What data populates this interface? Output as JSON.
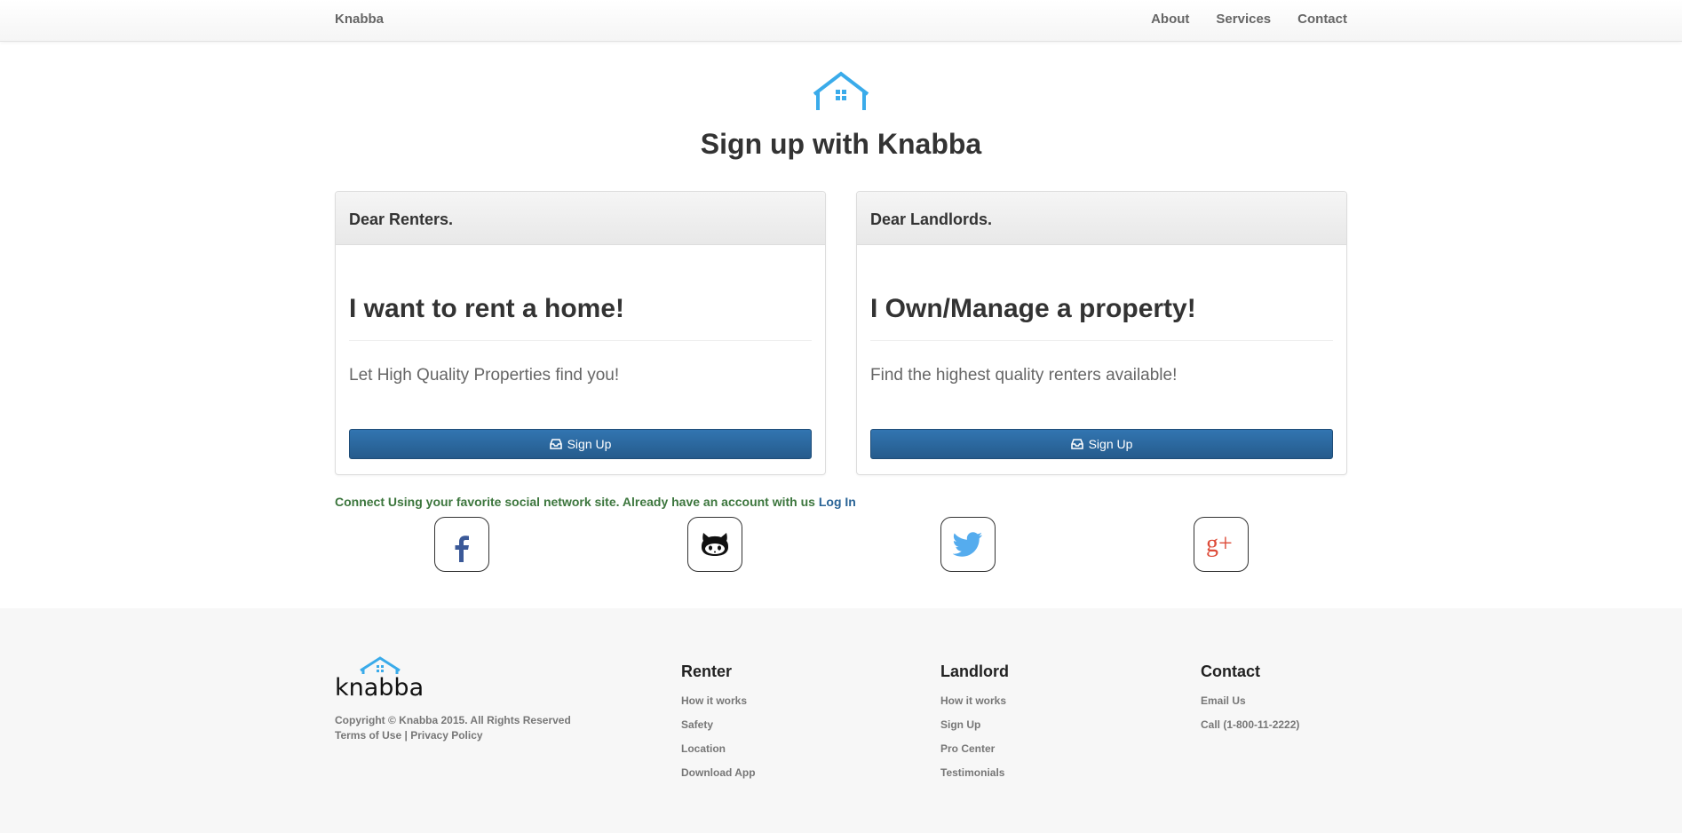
{
  "navbar": {
    "brand": "Knabba",
    "links": [
      "About",
      "Services",
      "Contact"
    ]
  },
  "hero": {
    "icon": "house-icon",
    "title": "Sign up with Knabba"
  },
  "cards": [
    {
      "header": "Dear Renters.",
      "heading": "I want to rent a home!",
      "text": "Let High Quality Properties find you!",
      "button": "Sign Up",
      "button_icon": "inbox-icon"
    },
    {
      "header": "Dear Landlords.",
      "heading": "I Own/Manage a property!",
      "text": "Find the highest quality renters available!",
      "button": "Sign Up",
      "button_icon": "inbox-icon"
    }
  ],
  "connect": {
    "text": "Connect Using your favorite social network site. Already have an account with us",
    "login_link": "Log In"
  },
  "social": [
    {
      "name": "facebook",
      "icon": "facebook-icon",
      "color": "#3b5998"
    },
    {
      "name": "github",
      "icon": "github-icon",
      "color": "#222222"
    },
    {
      "name": "twitter",
      "icon": "twitter-icon",
      "color": "#55acee"
    },
    {
      "name": "google-plus",
      "icon": "google-plus-icon",
      "color": "#dd4b39"
    }
  ],
  "footer": {
    "logo_text": "knabba",
    "copyright": "Copyright © Knabba 2015. All Rights Reserved",
    "terms": "Terms of Use",
    "separator": "|",
    "privacy": "Privacy Policy",
    "columns": [
      {
        "title": "Renter",
        "links": [
          "How it works",
          "Safety",
          "Location",
          "Download App"
        ]
      },
      {
        "title": "Landlord",
        "links": [
          "How it works",
          "Sign Up",
          "Pro Center",
          "Testimonials"
        ]
      },
      {
        "title": "Contact",
        "links": [
          "Email Us",
          "Call (1-800-11-2222)"
        ]
      }
    ]
  },
  "colors": {
    "accent": "#3aabea",
    "button": "#2a6496",
    "connect_text": "#3c763d"
  }
}
